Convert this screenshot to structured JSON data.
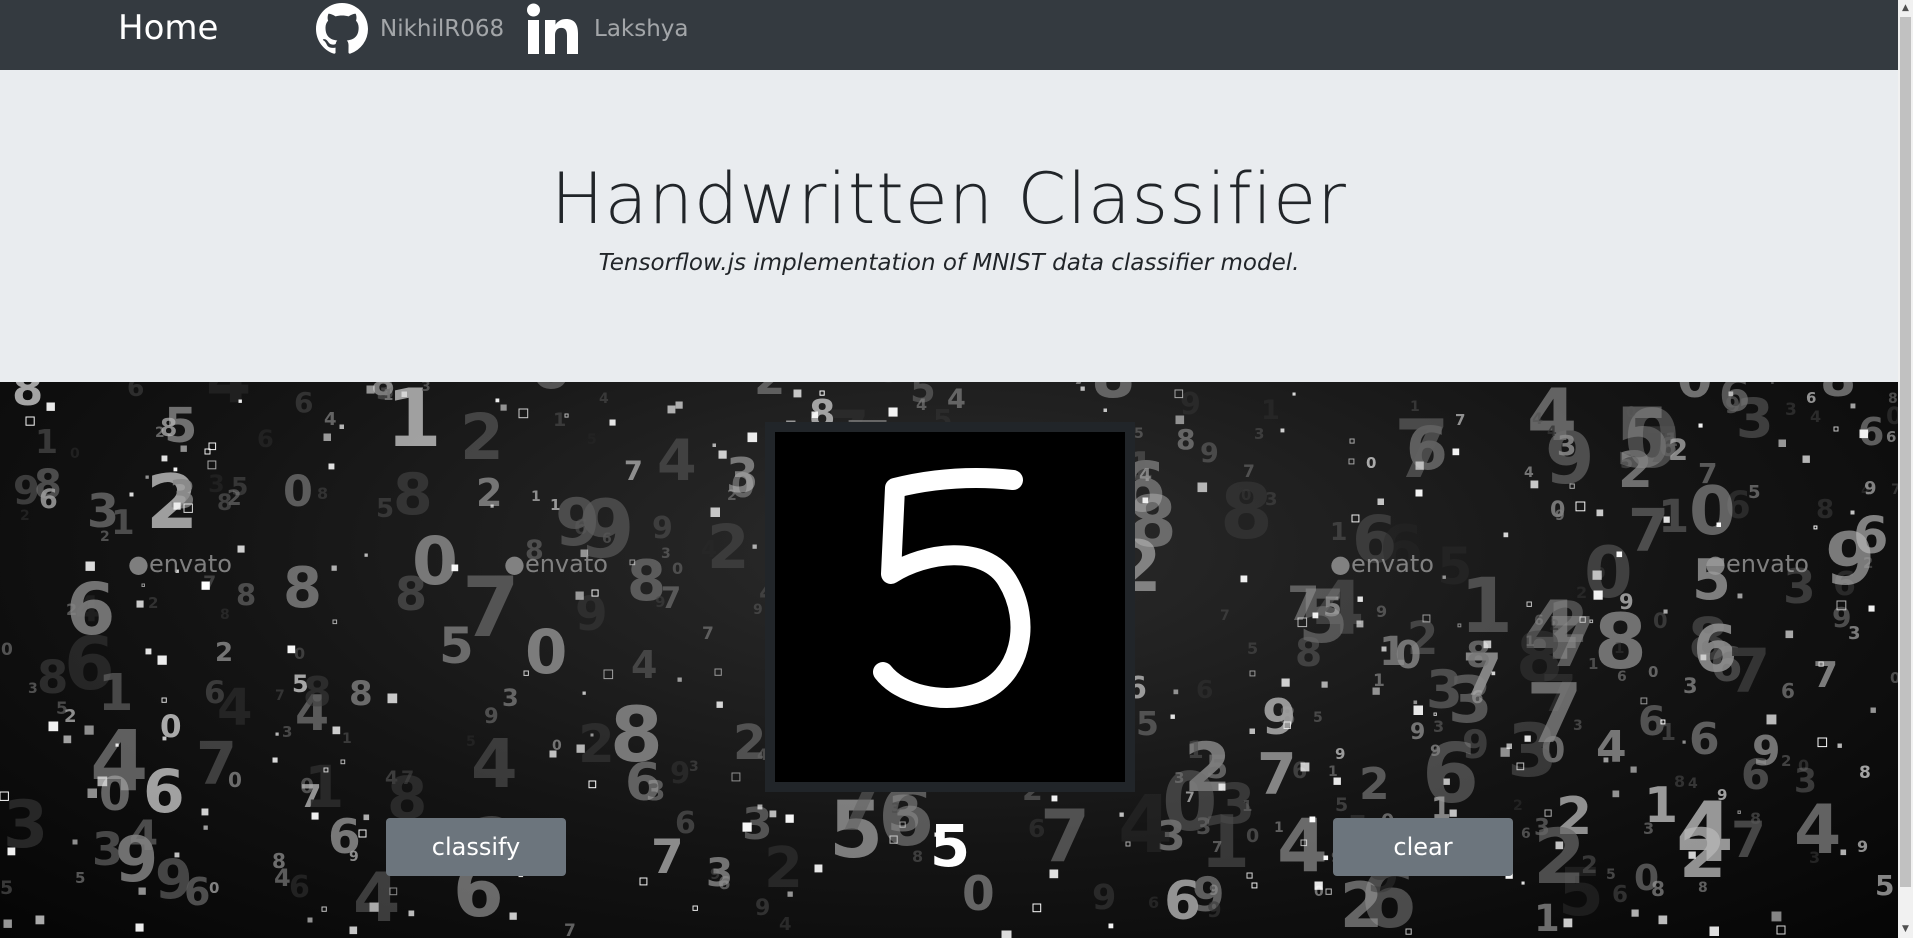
{
  "navbar": {
    "home_label": "Home",
    "github_label": "NikhilR068",
    "linkedin_label": "Lakshya"
  },
  "hero": {
    "title": "Handwritten Classifier",
    "subtitle": "Tensorflow.js implementation of MNIST data classifier model."
  },
  "classifier": {
    "classify_label": "classify",
    "clear_label": "clear",
    "prediction": "5"
  },
  "background": {
    "watermark": "envato"
  },
  "colors": {
    "navbar": "#343a40",
    "jumbotron": "#e9ecef",
    "button": "#6c757d",
    "canvas_border": "#212529"
  }
}
